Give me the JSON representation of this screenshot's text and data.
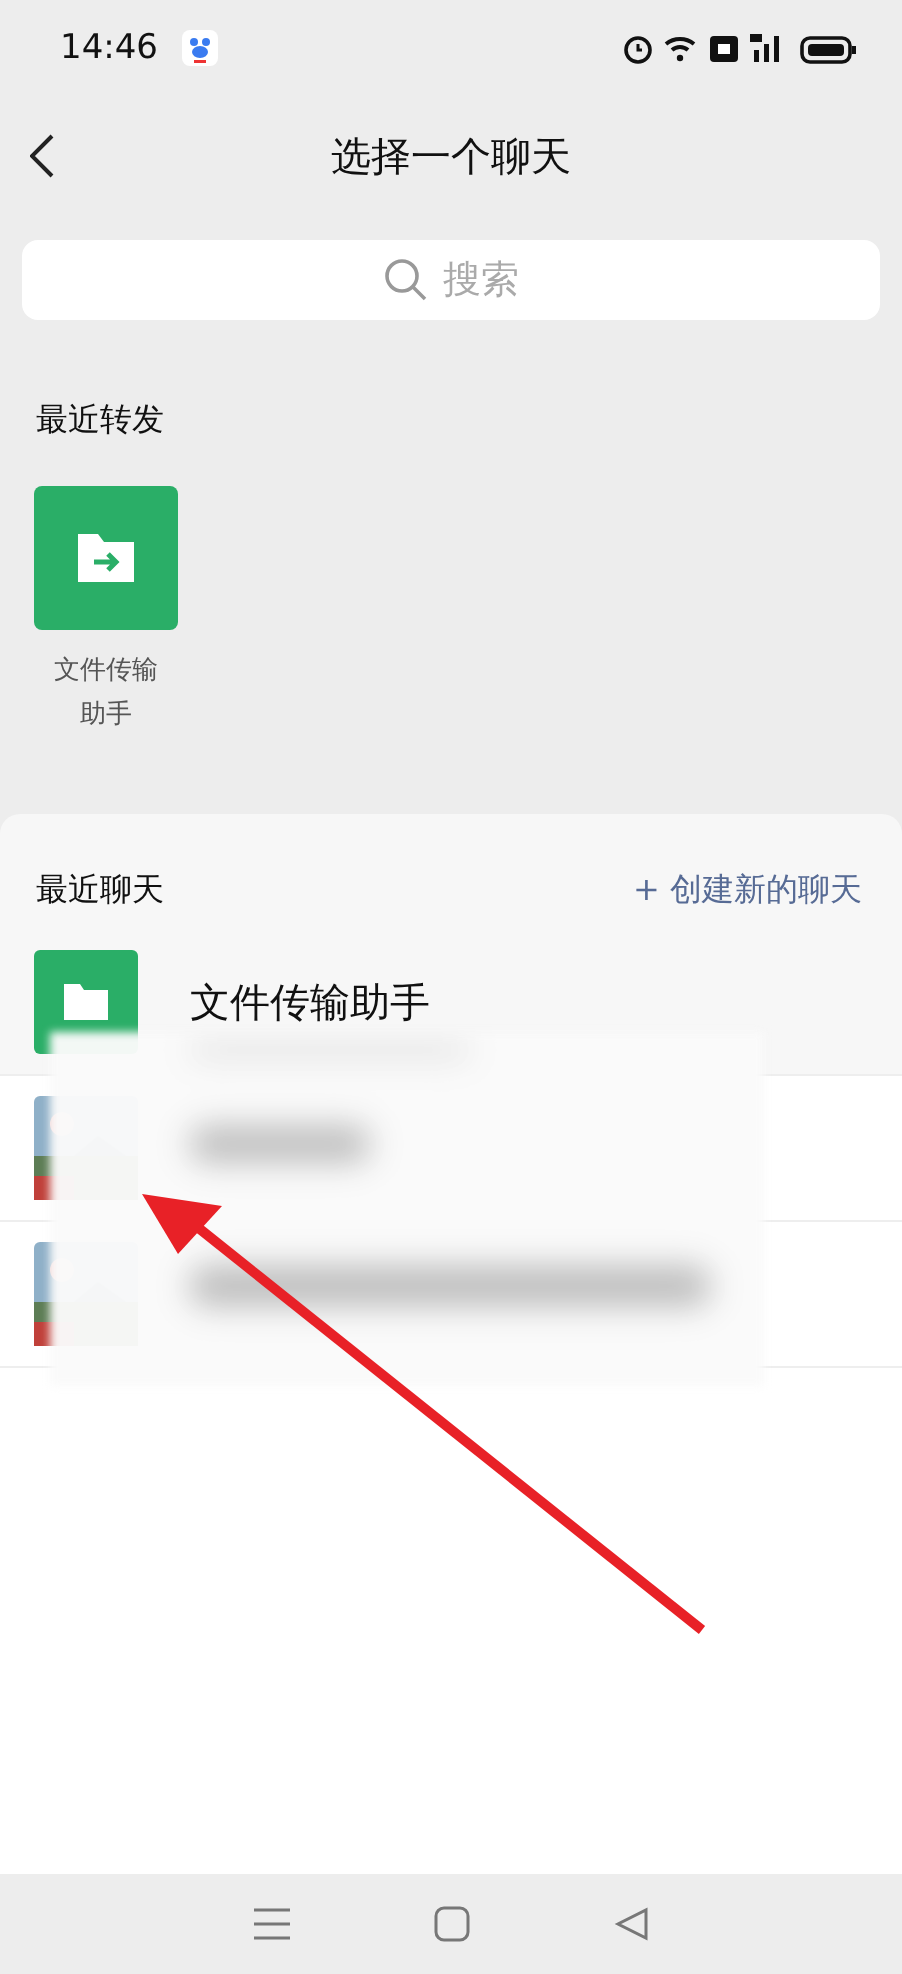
{
  "status_bar": {
    "time": "14:46"
  },
  "header": {
    "title": "选择一个聊天"
  },
  "search": {
    "placeholder": "搜索"
  },
  "recent_forward": {
    "title": "最近转发",
    "items": [
      {
        "label": "文件传输助手",
        "kind": "file"
      }
    ]
  },
  "recent_chats": {
    "title": "最近聊天",
    "new_chat": "+ 创建新的聊天",
    "rows": [
      {
        "kind": "file",
        "name": "文件传输助手"
      },
      {
        "kind": "picture"
      },
      {
        "kind": "picture"
      }
    ]
  }
}
